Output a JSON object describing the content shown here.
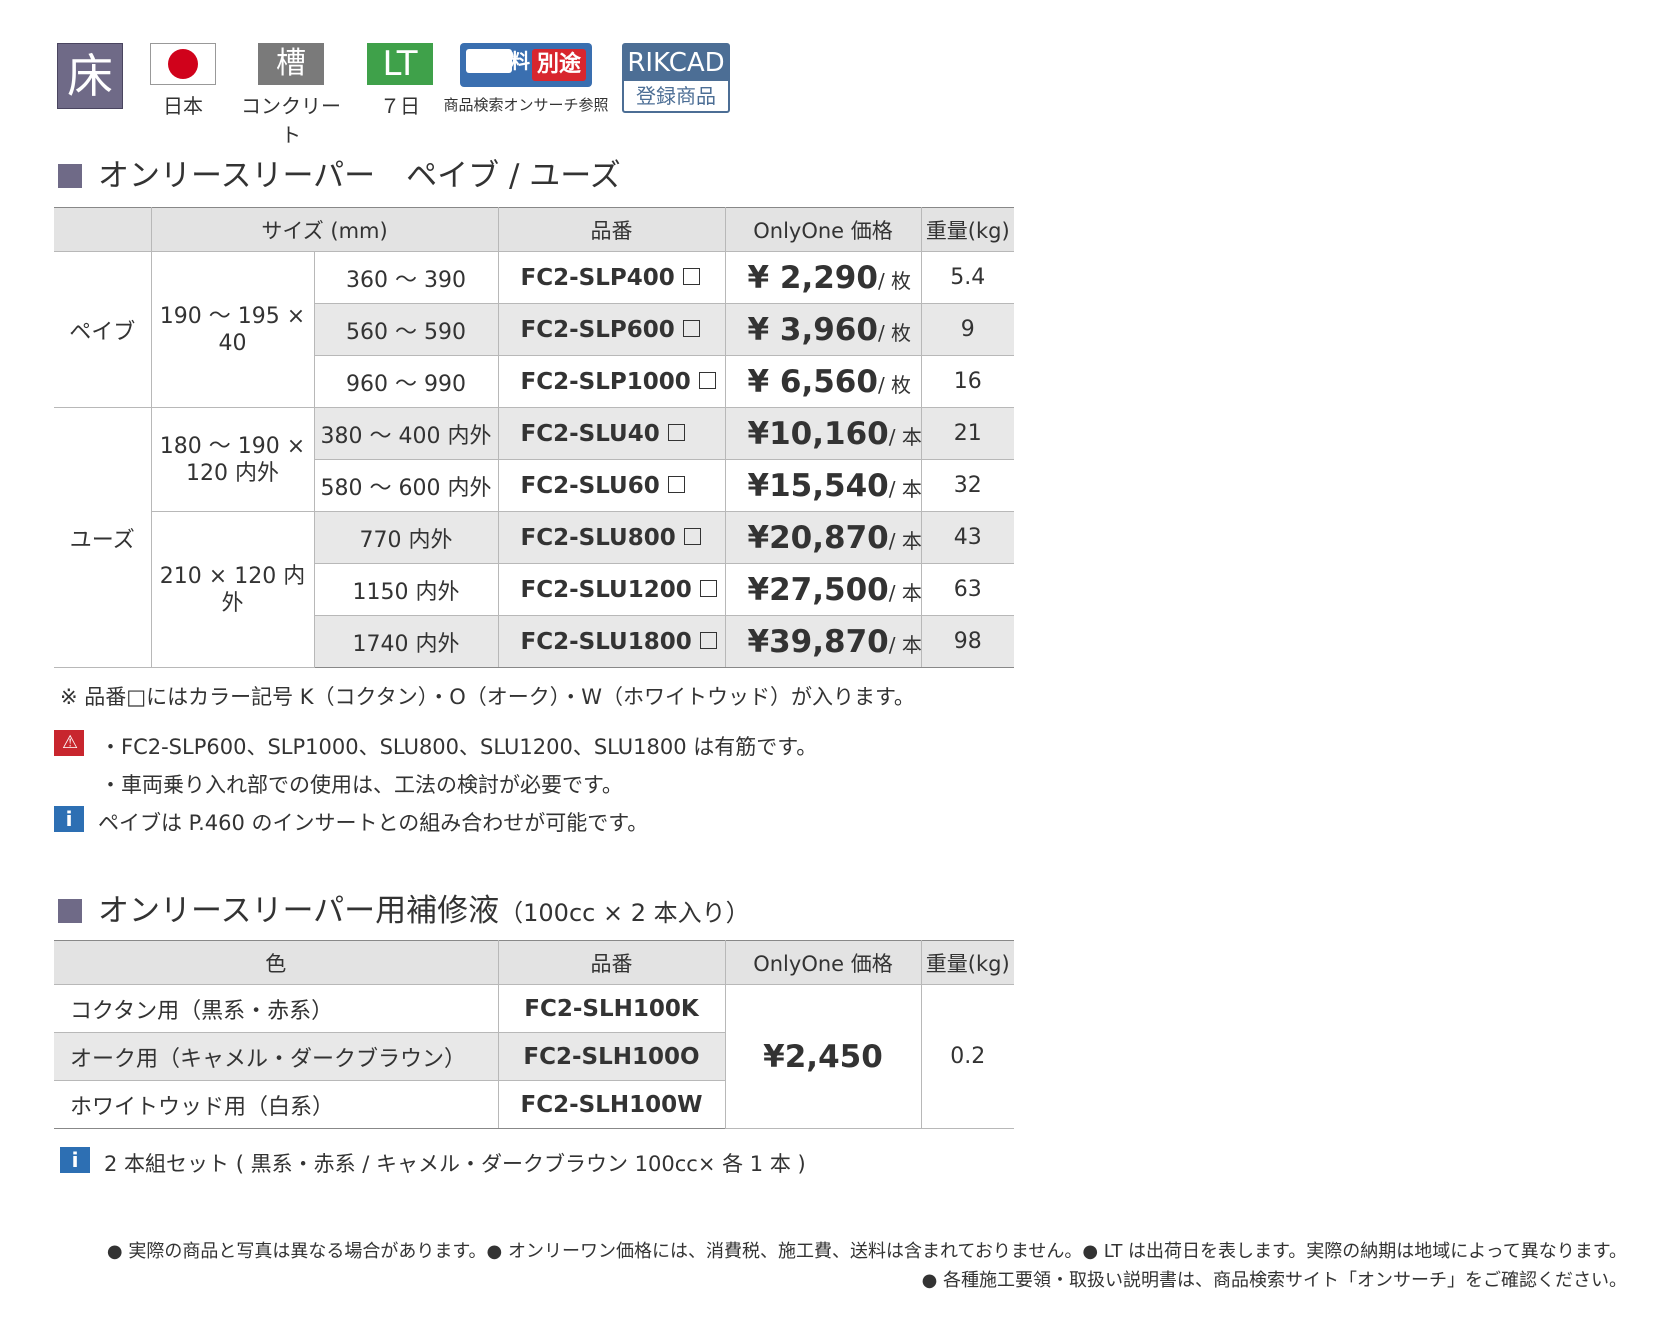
{
  "header_icons": {
    "floor_glyph": "床",
    "origin_label": "日本",
    "material_glyph": "槽",
    "material_label": "コンクリート",
    "lt_glyph": "LT",
    "lt_label": "７日",
    "shipping_badge_left": "送料",
    "shipping_badge_right": "別途",
    "shipping_label": "商品検索オンサーチ参照",
    "rikcad_top": "RIKCAD",
    "rikcad_bottom": "登録商品"
  },
  "section1": {
    "title": "オンリースリーパー　ペイブ / ユーズ",
    "headers": {
      "size": "サイズ (mm)",
      "part": "品番",
      "price": "OnlyOne 価格",
      "weight": "重量(kg)"
    },
    "groups": [
      {
        "name": "ペイブ",
        "subgroups": [
          {
            "section": "190 ～ 195 × 40",
            "rows": [
              {
                "length": "360 ～ 390",
                "part": "FC2-SLP400",
                "price": "¥  2,290",
                "unit": "/ 枚",
                "weight": "5.4"
              },
              {
                "length": "560 ～ 590",
                "part": "FC2-SLP600",
                "price": "¥  3,960",
                "unit": "/ 枚",
                "weight": "9"
              },
              {
                "length": "960 ～ 990",
                "part": "FC2-SLP1000",
                "price": "¥  6,560",
                "unit": "/ 枚",
                "weight": "16"
              }
            ]
          }
        ]
      },
      {
        "name": "ユーズ",
        "subgroups": [
          {
            "section": "180 ～ 190 × 120 内外",
            "rows": [
              {
                "length": "380 ～ 400 内外",
                "part": "FC2-SLU40",
                "price": "¥10,160",
                "unit": "/ 本",
                "weight": "21"
              },
              {
                "length": "580 ～ 600 内外",
                "part": "FC2-SLU60",
                "price": "¥15,540",
                "unit": "/ 本",
                "weight": "32"
              }
            ]
          },
          {
            "section": "210 × 120 内外",
            "rows": [
              {
                "length": "770 内外",
                "part": "FC2-SLU800",
                "price": "¥20,870",
                "unit": "/ 本",
                "weight": "43"
              },
              {
                "length": "1150 内外",
                "part": "FC2-SLU1200",
                "price": "¥27,500",
                "unit": "/ 本",
                "weight": "63"
              },
              {
                "length": "1740 内外",
                "part": "FC2-SLU1800",
                "price": "¥39,870",
                "unit": "/ 本",
                "weight": "98"
              }
            ]
          }
        ]
      }
    ],
    "note_color": "※ 品番□にはカラー記号 K（コクタン）・O（オーク）・W（ホワイトウッド）が入ります。",
    "warn_lines": [
      "・FC2-SLP600、SLP1000、SLU800、SLU1200、SLU1800 は有筋です。",
      "・車両乗り入れ部での使用は、工法の検討が必要です。"
    ],
    "info_line": "ペイブは P.460 のインサートとの組み合わせが可能です。"
  },
  "section2": {
    "title": "オンリースリーパー用補修液",
    "title_sub": "（100cc × 2 本入り）",
    "headers": {
      "color": "色",
      "part": "品番",
      "price": "OnlyOne 価格",
      "weight": "重量(kg)"
    },
    "rows": [
      {
        "color": "コクタン用（黒系・赤系）",
        "part": "FC2-SLH100K"
      },
      {
        "color": "オーク用（キャメル・ダークブラウン）",
        "part": "FC2-SLH100O"
      },
      {
        "color": "ホワイトウッド用（白系）",
        "part": "FC2-SLH100W"
      }
    ],
    "price": "¥2,450",
    "weight": "0.2",
    "info_line": "2 本組セット ( 黒系・赤系 / キャメル・ダークブラウン 100cc× 各 1 本 )"
  },
  "footer": {
    "line1": "● 実際の商品と写真は異なる場合があります。● オンリーワン価格には、消費税、施工費、送料は含まれておりません。● LT は出荷日を表します。実際の納期は地域によって異なります。",
    "line2": "● 各種施工要領・取扱い説明書は、商品検索サイト「オンサーチ」をご確認ください。"
  },
  "colors": {
    "title_square": "#6f6a87",
    "warn": "#c8262e",
    "info": "#2d6fb3",
    "table_header": "#e3e3e3"
  }
}
